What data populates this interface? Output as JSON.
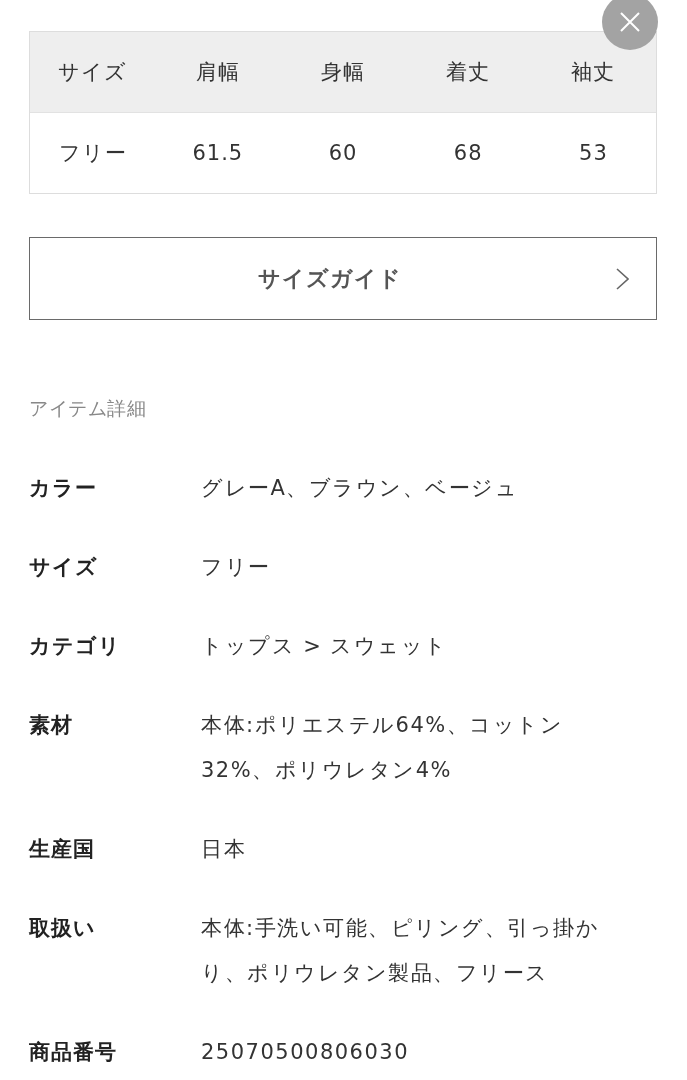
{
  "size_table": {
    "columns": [
      "サイズ",
      "肩幅",
      "身幅",
      "着丈",
      "袖丈"
    ],
    "rows": [
      [
        "フリー",
        "61.5",
        "60",
        "68",
        "53"
      ]
    ]
  },
  "size_guide_button": {
    "label": "サイズガイド"
  },
  "item_details": {
    "title": "アイテム詳細",
    "rows": [
      {
        "label": "カラー",
        "value": "グレーA、ブラウン、ベージュ"
      },
      {
        "label": "サイズ",
        "value": "フリー"
      },
      {
        "label": "カテゴリ",
        "value": "トップス > スウェット"
      },
      {
        "label": "素材",
        "value": "本体:ポリエステル64%、コットン32%、ポリウレタン4%"
      },
      {
        "label": "生産国",
        "value": "日本"
      },
      {
        "label": "取扱い",
        "value": "本体:手洗い可能、ピリング、引っ掛かり、ポリウレタン製品、フリース"
      },
      {
        "label": "商品番号",
        "value": "25070500806030"
      }
    ]
  }
}
